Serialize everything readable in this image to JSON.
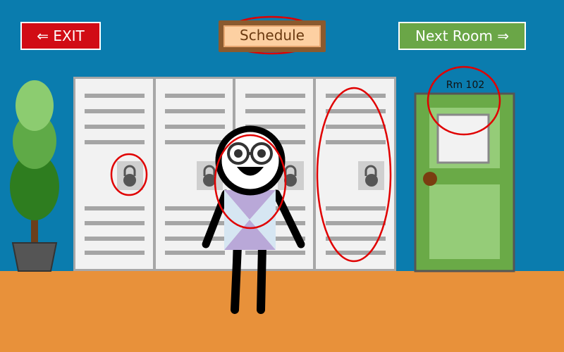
{
  "colors": {
    "wall": "#0a7cae",
    "floor": "#e8913a",
    "locker": "#f2f2f2",
    "locker_frame": "#a7a7a7",
    "door": "#6aaa47",
    "door_panel": "#95cc78",
    "exit_button": "#d10c15",
    "next_button": "#6aa647",
    "sign_bg": "#fdd0a2",
    "highlight": "#e00000",
    "shirt": "#b9a8d8"
  },
  "buttons": {
    "exit_label": "⇐ EXIT",
    "next_label": "Next Room ⇒"
  },
  "sign": {
    "schedule_label": "Schedule"
  },
  "door": {
    "room_label": "Rm 102"
  },
  "icons": {
    "lock": "padlock-icon",
    "plant": "potted-plant",
    "character": "stick-figure"
  }
}
